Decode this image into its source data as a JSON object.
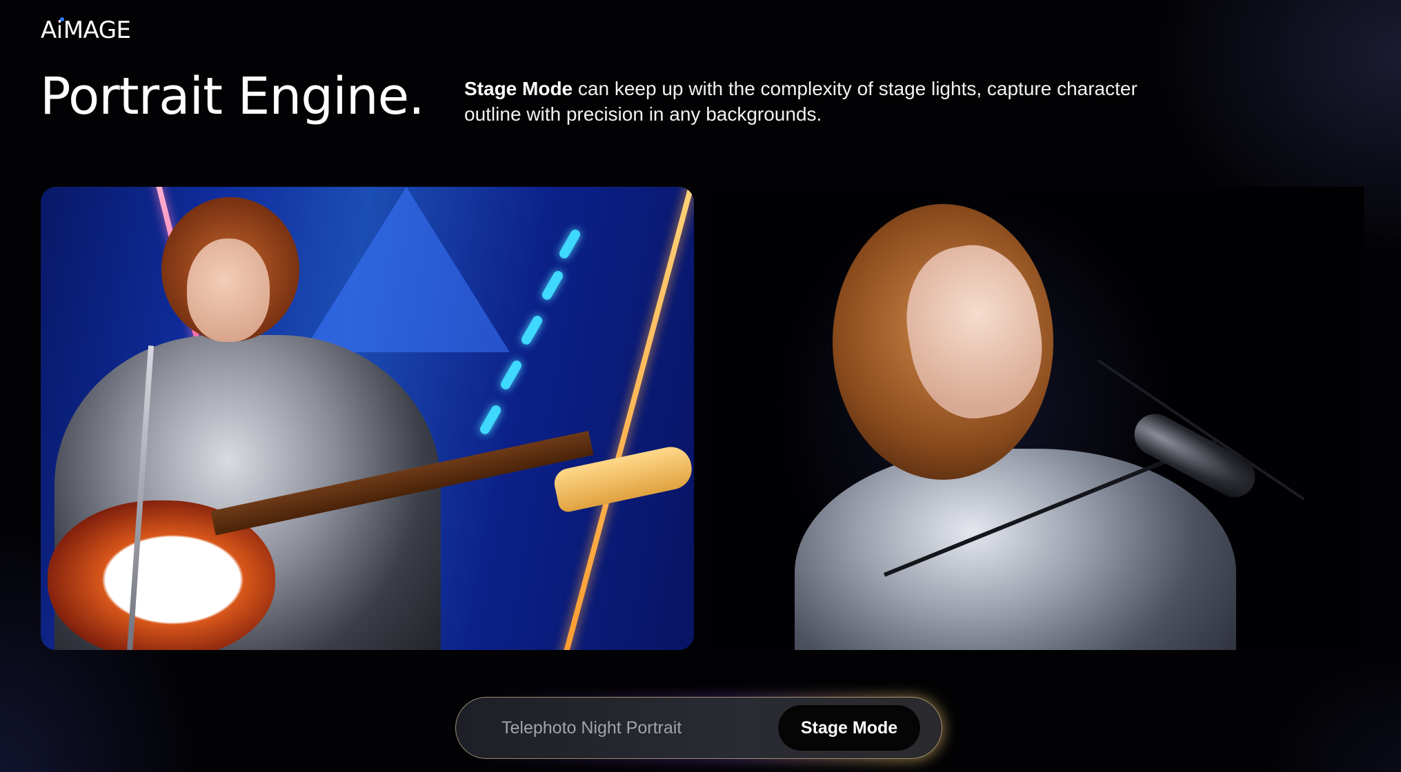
{
  "brand": {
    "logo_prefix": "A",
    "logo_i": "i",
    "logo_suffix": "MAGE",
    "dot_color": "#2f7bff"
  },
  "hero": {
    "title": "Portrait Engine.",
    "description_strong": "Stage Mode",
    "description_rest": " can keep up with the complexity of stage lights, capture character outline with precision in any backgrounds."
  },
  "photos": {
    "left": {
      "subject": "stage performer with bass guitar under blue lights"
    },
    "right": {
      "subject": "singer at microphone against dark background"
    }
  },
  "mode_toggle": {
    "options": [
      {
        "label": "Telephoto Night Portrait",
        "active": false
      },
      {
        "label": "Stage Mode",
        "active": true
      }
    ],
    "accent": "#ffe2aa"
  }
}
